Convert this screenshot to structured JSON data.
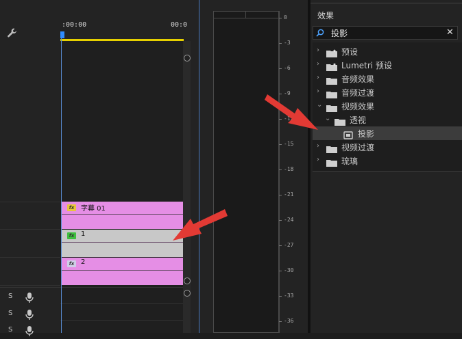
{
  "timeline": {
    "timecode_start": ":00:00",
    "timecode_end": "00:0",
    "video_clips": [
      {
        "name": "字幕  01",
        "color": "#e58ee5",
        "fx_color": "#e6c63a"
      },
      {
        "name": "1",
        "color": "#c8c8c8",
        "fx_color": "#3fbf3f"
      },
      {
        "name": "2",
        "color": "#e58ee5",
        "fx_color": "#cfcfe8"
      }
    ],
    "audio_tracks": [
      {
        "solo": "S"
      },
      {
        "solo": "S"
      },
      {
        "solo": "S"
      }
    ]
  },
  "meter": {
    "marks": [
      "0",
      "-3",
      "-6",
      "-9",
      "-12",
      "-15",
      "-18",
      "-21",
      "-24",
      "-27",
      "-30",
      "-33",
      "-36"
    ]
  },
  "effects": {
    "title": "效果",
    "search_value": "投影",
    "tree": [
      {
        "label": "预设",
        "depth": 0,
        "expanded": false,
        "icon": "preset-folder"
      },
      {
        "label": "Lumetri 预设",
        "depth": 0,
        "expanded": false,
        "icon": "preset-folder"
      },
      {
        "label": "音频效果",
        "depth": 0,
        "expanded": false,
        "icon": "folder"
      },
      {
        "label": "音频过渡",
        "depth": 0,
        "expanded": false,
        "icon": "folder"
      },
      {
        "label": "视频效果",
        "depth": 0,
        "expanded": true,
        "icon": "folder"
      },
      {
        "label": "透视",
        "depth": 1,
        "expanded": true,
        "icon": "folder"
      },
      {
        "label": "投影",
        "depth": 2,
        "expanded": null,
        "icon": "effect",
        "selected": true
      },
      {
        "label": "视频过渡",
        "depth": 0,
        "expanded": false,
        "icon": "folder"
      },
      {
        "label": "琉璃",
        "depth": 0,
        "expanded": false,
        "icon": "folder"
      }
    ]
  },
  "colors": {
    "annotation_arrow": "#e23a34",
    "playhead": "#2f8cff",
    "work_area": "#e6d000"
  }
}
